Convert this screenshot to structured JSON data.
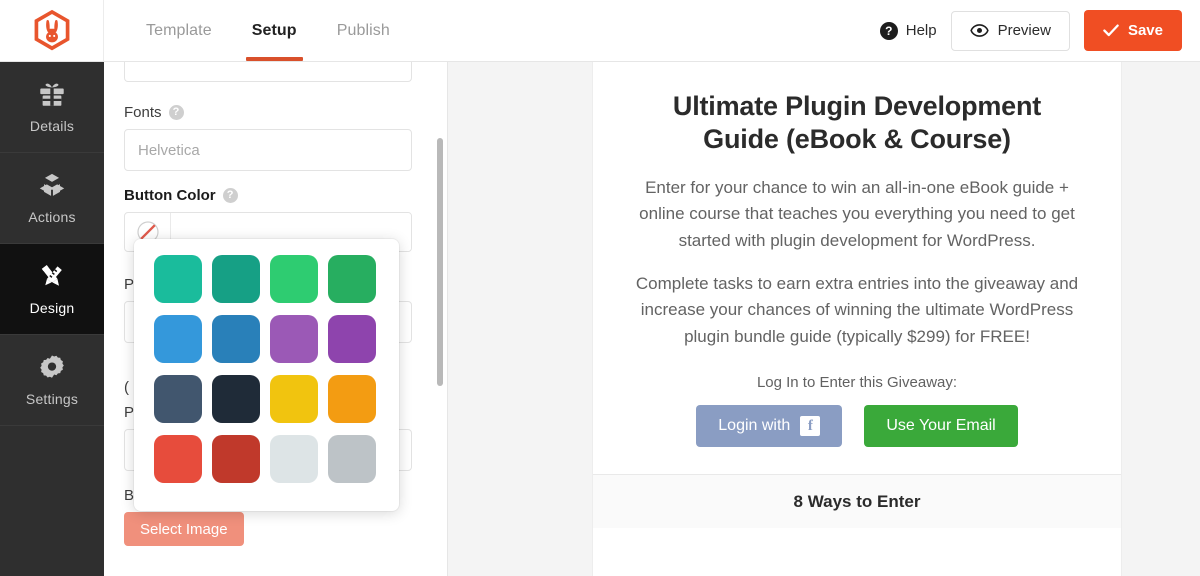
{
  "app": {
    "logo_name": "rafflepress-bunny-logo",
    "brand_color": "#f04e23"
  },
  "topbar": {
    "tabs": [
      {
        "label": "Template",
        "active": false
      },
      {
        "label": "Setup",
        "active": true
      },
      {
        "label": "Publish",
        "active": false
      }
    ],
    "help_label": "Help",
    "help_icon": "question-mark-circle-icon",
    "preview_label": "Preview",
    "preview_icon": "eye-icon",
    "save_label": "Save",
    "save_icon": "check-icon",
    "save_color": "#f04e23"
  },
  "sidebar": {
    "items": [
      {
        "label": "Details",
        "icon": "gift-icon",
        "active": false
      },
      {
        "label": "Actions",
        "icon": "blocks-icon",
        "active": false
      },
      {
        "label": "Design",
        "icon": "pencil-ruler-icon",
        "active": true
      },
      {
        "label": "Settings",
        "icon": "gear-icon",
        "active": false
      }
    ]
  },
  "panel": {
    "fonts": {
      "label": "Fonts",
      "hint_icon": "help-circle-icon",
      "placeholder": "Helvetica",
      "value": ""
    },
    "button_color": {
      "label": "Button Color",
      "hint_icon": "help-circle-icon",
      "swatch_icon": "no-color-icon",
      "value": ""
    },
    "background_image": {
      "label": "Background Image",
      "hint_icon": "help-circle-icon",
      "select_label": "Select Image",
      "select_color": "#f0907c"
    },
    "scrollbar": "vertical-scrollbar"
  },
  "color_picker": {
    "name": "button-color-palette-popover",
    "swatches": [
      {
        "name": "turquoise",
        "hex": "#1abc9c"
      },
      {
        "name": "green-sea",
        "hex": "#16a085"
      },
      {
        "name": "emerald",
        "hex": "#2ecc71"
      },
      {
        "name": "nephritis",
        "hex": "#27ae60"
      },
      {
        "name": "peter-river",
        "hex": "#3498db"
      },
      {
        "name": "belize-hole",
        "hex": "#2980b9"
      },
      {
        "name": "amethyst",
        "hex": "#9b59b6"
      },
      {
        "name": "wisteria",
        "hex": "#8e44ad"
      },
      {
        "name": "wet-asphalt",
        "hex": "#41566e"
      },
      {
        "name": "midnight-blue",
        "hex": "#1f2b38"
      },
      {
        "name": "sunflower",
        "hex": "#f1c40f"
      },
      {
        "name": "orange",
        "hex": "#f39c12"
      },
      {
        "name": "alizarin",
        "hex": "#e74c3c"
      },
      {
        "name": "pomegranate",
        "hex": "#c0392b"
      },
      {
        "name": "clouds",
        "hex": "#dde4e6"
      },
      {
        "name": "silver",
        "hex": "#bdc3c7"
      }
    ]
  },
  "preview": {
    "title": "Ultimate Plugin Development Guide (eBook & Course)",
    "paragraph_1": "Enter for your chance to win an all-in-one eBook guide + online course that teaches you everything you need to get started with plugin development for WordPress.",
    "paragraph_2": "Complete tasks to earn extra entries into the giveaway and increase your chances of winning the ultimate WordPress plugin bundle guide (typically $299) for FREE!",
    "login_prompt": "Log In to Enter this Giveaway:",
    "facebook_label": "Login with",
    "facebook_icon": "facebook-icon",
    "facebook_color": "#8a9dc3",
    "email_label": "Use Your Email",
    "email_color": "#3aa93a",
    "ways_to_enter": "8 Ways to Enter"
  }
}
